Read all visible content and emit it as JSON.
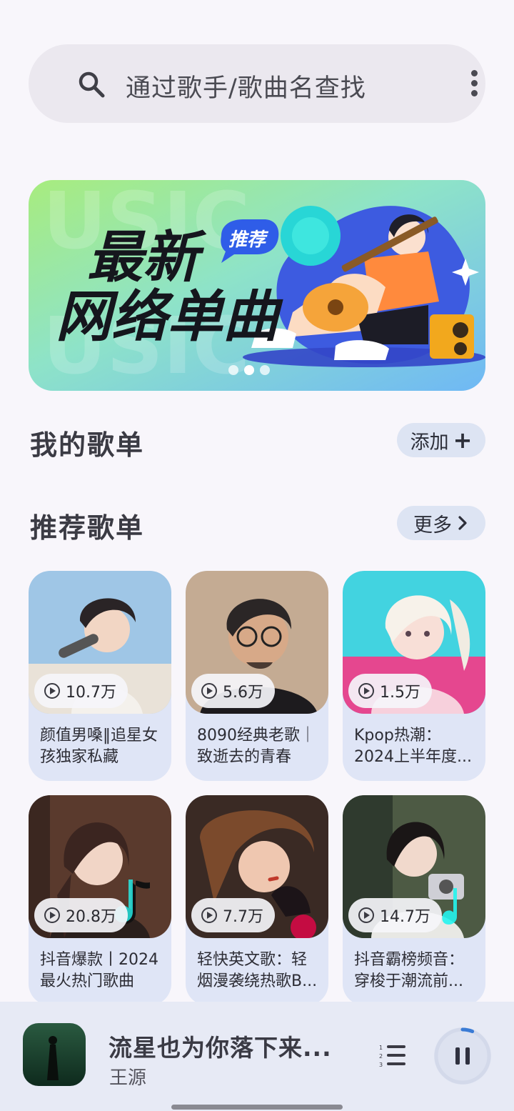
{
  "search": {
    "placeholder": "通过歌手/歌曲名查找",
    "icon": "search-icon",
    "menu_icon": "more-vertical-icon"
  },
  "banner": {
    "line1": "最新",
    "line2": "网络单曲",
    "badge": "推荐",
    "tag": "KUWO MUSIC KUWO MUSIC",
    "active_dot": 1,
    "dot_count": 3
  },
  "my_playlists": {
    "title": "我的歌单",
    "button_label": "添加",
    "button_icon": "plus-icon"
  },
  "recommended": {
    "title": "推荐歌单",
    "button_label": "更多",
    "button_icon": "chevron-right-icon",
    "cards": [
      {
        "plays": "10.7万",
        "title": "颜值男嗓‖追星女孩独家私藏"
      },
      {
        "plays": "5.6万",
        "title": "8090经典老歌｜致逝去的青春"
      },
      {
        "plays": "1.5万",
        "title": "Kpop热潮：2024上半年度..."
      },
      {
        "plays": "20.8万",
        "title": "抖音爆款丨2024最火热门歌曲"
      },
      {
        "plays": "7.7万",
        "title": "轻快英文歌：轻烟漫袭绕热歌B..."
      },
      {
        "plays": "14.7万",
        "title": "抖音霸榜频音：穿梭于潮流前..."
      }
    ]
  },
  "player": {
    "song": "流星也为你落下来...",
    "artist": "王源",
    "queue_icon": "playlist-icon",
    "pause_icon": "pause-icon",
    "progress": 0.06
  },
  "colors": {
    "accent": "#3a7bd5",
    "card_bg": "#dfe5f6",
    "page_bg": "#f8f6fb"
  }
}
